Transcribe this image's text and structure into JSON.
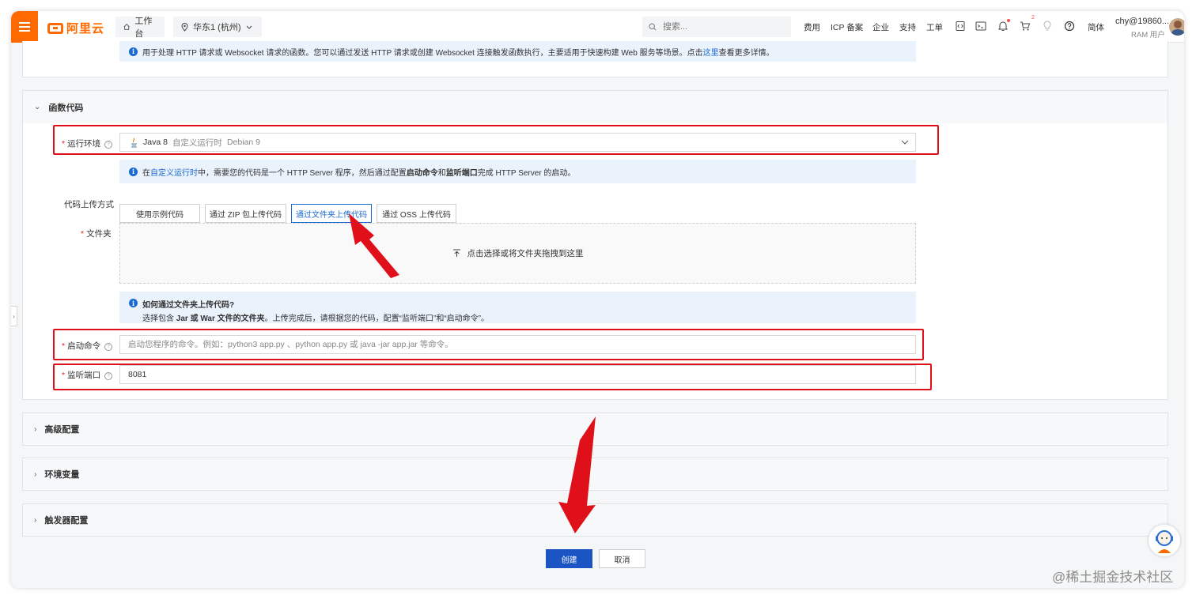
{
  "colors": {
    "brand": "#ff6a00",
    "primary": "#1b55c4",
    "link": "#1b6ad1",
    "annotation": "#e0101a",
    "notice_bg": "#eaf2fc"
  },
  "topbar": {
    "logo_text": "阿里云",
    "workbench": "工作台",
    "region": "华东1 (杭州)",
    "search_placeholder": "搜索...",
    "links": [
      "费用",
      "ICP 备案",
      "企业",
      "支持",
      "工单"
    ],
    "cart_count": "2",
    "language": "简体",
    "user_name": "chy@19860...",
    "user_role": "RAM 用户",
    "icons": [
      "menu-icon",
      "home-icon",
      "location-icon",
      "chevron-down-icon",
      "search-icon",
      "code-icon",
      "terminal-icon",
      "bell-icon",
      "cart-icon",
      "bulb-icon",
      "help-icon"
    ]
  },
  "top_notice": {
    "text": "用于处理 HTTP 请求或 Websocket 请求的函数。您可以通过发送 HTTP 请求或创建 Websocket 连接触发函数执行，主要适用于快速构建 Web 服务等场景。点击",
    "link": "这里",
    "suffix": "查看更多详情。"
  },
  "code_section": {
    "title": "函数代码",
    "runtime": {
      "label": "运行环境",
      "value": "Java 8",
      "sub1": "自定义运行时",
      "sub2": "Debian 9"
    },
    "runtime_notice": {
      "pre": "在",
      "link": "自定义运行时",
      "mid1": "中，需要您的代码是一个 HTTP Server 程序，然后通过配置",
      "b1": "启动命令",
      "mid2": "和",
      "b2": "监听端口",
      "post": "完成 HTTP Server 的启动。"
    },
    "upload_method": {
      "label": "代码上传方式",
      "options": [
        "使用示例代码",
        "通过 ZIP 包上传代码",
        "通过文件夹上传代码",
        "通过 OSS 上传代码"
      ],
      "selected": "通过文件夹上传代码"
    },
    "folder": {
      "label": "文件夹",
      "dropzone_text": "点击选择或将文件夹拖拽到这里"
    },
    "folder_notice": {
      "title": "如何通过文件夹上传代码?",
      "pre": "选择包含 ",
      "b": "Jar 或 War 文件的文件夹",
      "post": "。上传完成后，请根据您的代码，配置“监听端口”和“启动命令”。"
    },
    "start_command": {
      "label": "启动命令",
      "placeholder": "启动您程序的命令。例如：python3 app.py 、python app.py 或 java -jar app.jar 等命令。"
    },
    "listen_port": {
      "label": "监听端口",
      "value": "8081"
    }
  },
  "sections": [
    "高级配置",
    "环境变量",
    "触发器配置"
  ],
  "actions": {
    "create": "创建",
    "cancel": "取消"
  },
  "watermark": "@稀土掘金技术社区"
}
